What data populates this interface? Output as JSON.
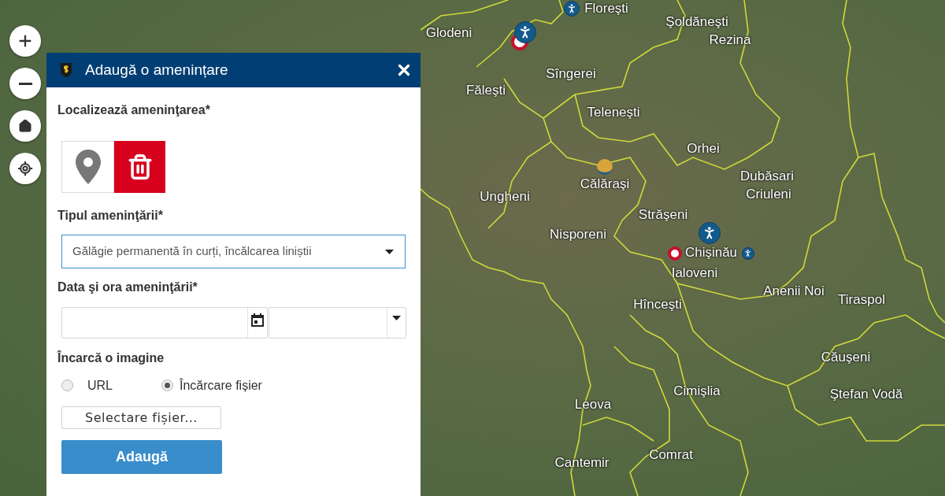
{
  "map_controls": [
    {
      "kind": "zoom_in"
    },
    {
      "kind": "zoom_out"
    },
    {
      "kind": "home"
    },
    {
      "kind": "locate"
    }
  ],
  "map": {
    "labels": [
      "Floreşti",
      "Şoldăneşti",
      "Glodeni",
      "Rezina",
      "Sîngerei",
      "Făleşti",
      "Teleneşti",
      "Orhei",
      "Dubăsari",
      "Călăraşi",
      "Ungheni",
      "Criuleni",
      "Străşeni",
      "Nisporeni",
      "Chişinău",
      "Ialoveni",
      "Anenii Noi",
      "Hînceşti",
      "Tiraspol",
      "Căuşeni",
      "Cimişlia",
      "Ştefan Vodă",
      "Leova",
      "Comrat",
      "Cantemir"
    ],
    "markers": [
      {
        "kind": "speed_sign"
      },
      {
        "kind": "pedestrian"
      },
      {
        "kind": "pedestrian"
      },
      {
        "kind": "generic"
      },
      {
        "kind": "speed_sign"
      },
      {
        "kind": "pedestrian"
      },
      {
        "kind": "pedestrian"
      }
    ]
  },
  "dialog": {
    "title": "Adaugă o amenințare",
    "location": {
      "label": "Localizează ameninţarea*"
    },
    "threat_type": {
      "label": "Tipul ameninţării*",
      "value": "Gălăgie permanentă în curți, încălcarea liniștii",
      "focused": true
    },
    "datetime": {
      "label": "Data şi ora ameninţării*"
    },
    "image": {
      "label": "Încarcă o imagine",
      "options": [
        {
          "label": "URL",
          "selected": false
        },
        {
          "label": "Încărcare fișier",
          "selected": true
        }
      ],
      "file_button": "Selectare fișier..."
    },
    "submit": "Adaugă"
  }
}
